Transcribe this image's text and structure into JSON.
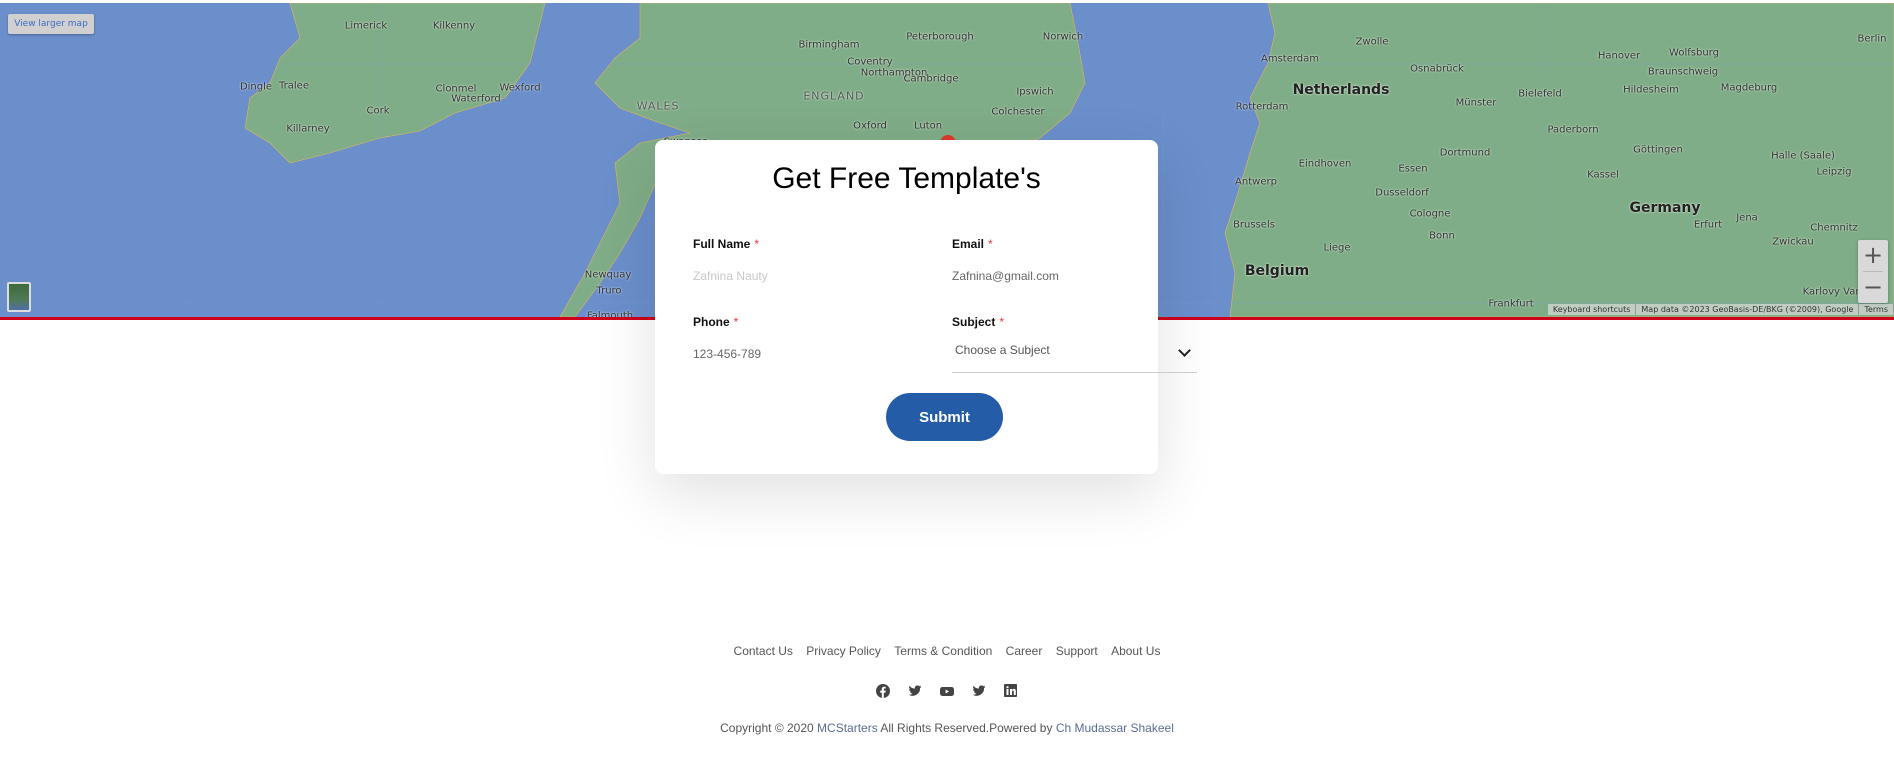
{
  "map": {
    "view_larger": "View larger map",
    "zoom_in": "+",
    "zoom_out": "−",
    "attribution": [
      "Keyboard shortcuts",
      "Map data ©2023 GeoBasis-DE/BKG (©2009), Google",
      "Terms"
    ],
    "labels": [
      "Limerick",
      "Kilkenny",
      "Tralee",
      "Dingle",
      "Killarney",
      "Cork",
      "Clonmel",
      "Waterford",
      "Wexford",
      "Birmingham",
      "ENGLAND",
      "WALES",
      "Peterborough",
      "Coventry",
      "Northampton",
      "Cambridge",
      "Oxford",
      "Luton",
      "Norwich",
      "Ipswich",
      "Colchester",
      "Swansea",
      "Newquay",
      "Truro",
      "Falmouth",
      "Amsterdam",
      "Netherlands",
      "Rotterdam",
      "Eindhoven",
      "Antwerp",
      "Brussels",
      "Belgium",
      "Liege",
      "Zwolle",
      "Osnabrück",
      "Münster",
      "Bielefeld",
      "Essen",
      "Dortmund",
      "Dusseldorf",
      "Cologne",
      "Bonn",
      "Frankfurt",
      "Paderborn",
      "Hanover",
      "Wolfsburg",
      "Braunschweig",
      "Hildesheim",
      "Magdeburg",
      "Berlin",
      "Göttingen",
      "Kassel",
      "Halle (Saale)",
      "Leipzig",
      "Germany",
      "Erfurt",
      "Jena",
      "Chemnitz",
      "Zwickau",
      "Karlovy Vary"
    ]
  },
  "form": {
    "title": "Get Free Template's",
    "required_mark": "*",
    "full_name": {
      "label": "Full Name",
      "placeholder": "Zafnina Nauty"
    },
    "email": {
      "label": "Email",
      "placeholder": "Zafnina@gmail.com"
    },
    "phone": {
      "label": "Phone",
      "placeholder": "123-456-789"
    },
    "subject": {
      "label": "Subject",
      "selected": "Choose a Subject"
    },
    "submit": "Submit"
  },
  "footer": {
    "links": [
      "Contact Us",
      "Privacy Policy",
      "Terms & Condition",
      "Career",
      "Support",
      "About Us"
    ],
    "social": [
      "facebook-icon",
      "twitter-icon",
      "youtube-icon",
      "twitter-icon",
      "linkedin-icon"
    ],
    "copyright_prefix": "Copyright © 2020 ",
    "brand": "MCStarters",
    "copyright_mid": " All Rights Reserved.Powered by ",
    "author": "Ch Mudassar Shakeel"
  }
}
